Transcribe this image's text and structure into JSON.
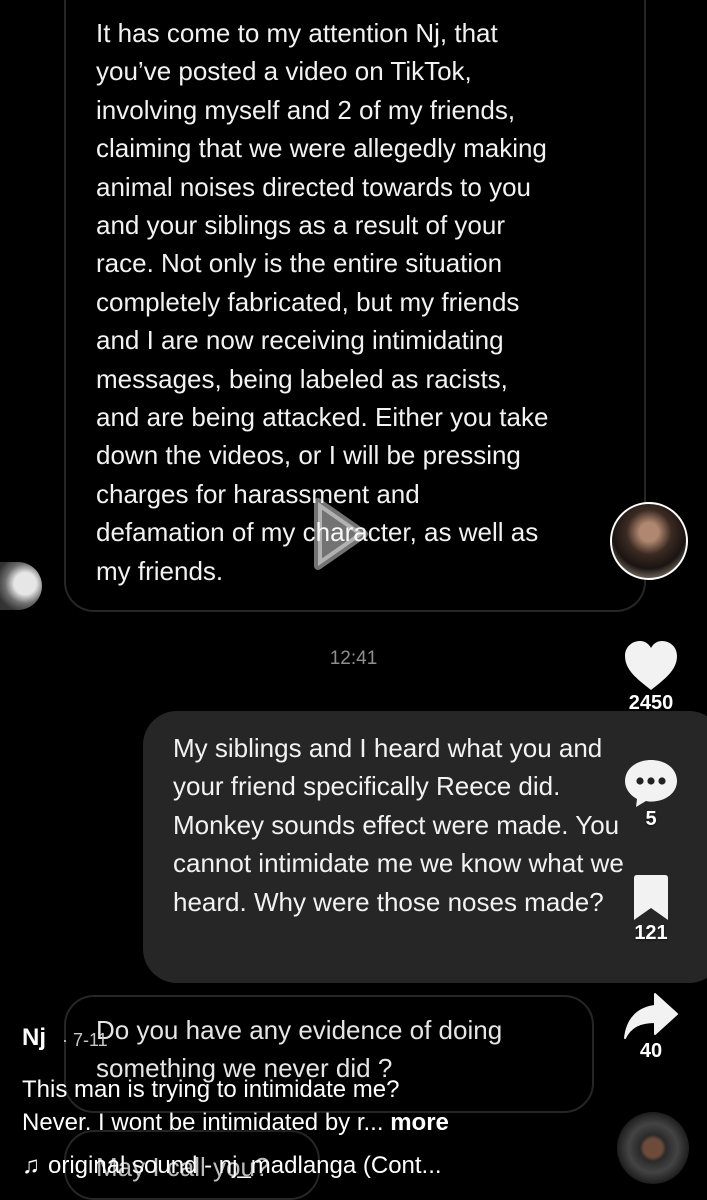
{
  "messages": {
    "incoming_1": {
      "lines": [
        "It has come to my attention Nj, that",
        "you’ve posted a video on TikTok,",
        "involving myself and 2 of my friends,",
        "claiming that we were allegedly making",
        "animal noises directed towards to you",
        "and your siblings as a result of your",
        "race. Not only is the entire situation",
        "completely fabricated, but my friends",
        "and I are now receiving intimidating",
        "messages, being labeled as racists,",
        "and are being attacked. Either you take",
        "down the videos, or I will be pressing",
        "charges for harassment and",
        "defamation of my character, as well as",
        "my friends."
      ]
    },
    "timestamp": "12:41",
    "outgoing_1": {
      "lines": [
        "My siblings and I heard what you and",
        "your friend specifically Reece did.",
        "Monkey sounds effect were made. You",
        "cannot intimidate me we know what we",
        "heard. Why were those noses made?"
      ]
    },
    "incoming_2": {
      "lines": [
        "Do you have any evidence of doing",
        "something we never did ?"
      ]
    },
    "incoming_3": {
      "text": "May I call you?"
    }
  },
  "actions": {
    "likes": "2450",
    "comments": "5",
    "saves": "121",
    "shares": "40"
  },
  "post": {
    "username": "Nj",
    "time": "· 7-11",
    "caption_line1": "This man is trying to intimidate me?",
    "caption_line2": "Never. I wont be intimidated by r...",
    "more": "more",
    "sound": "original sound - nj_madlanga (Cont..."
  },
  "icons": [
    "play-icon",
    "heart-icon",
    "comment-icon",
    "bookmark-icon",
    "share-icon",
    "music-note-icon"
  ]
}
